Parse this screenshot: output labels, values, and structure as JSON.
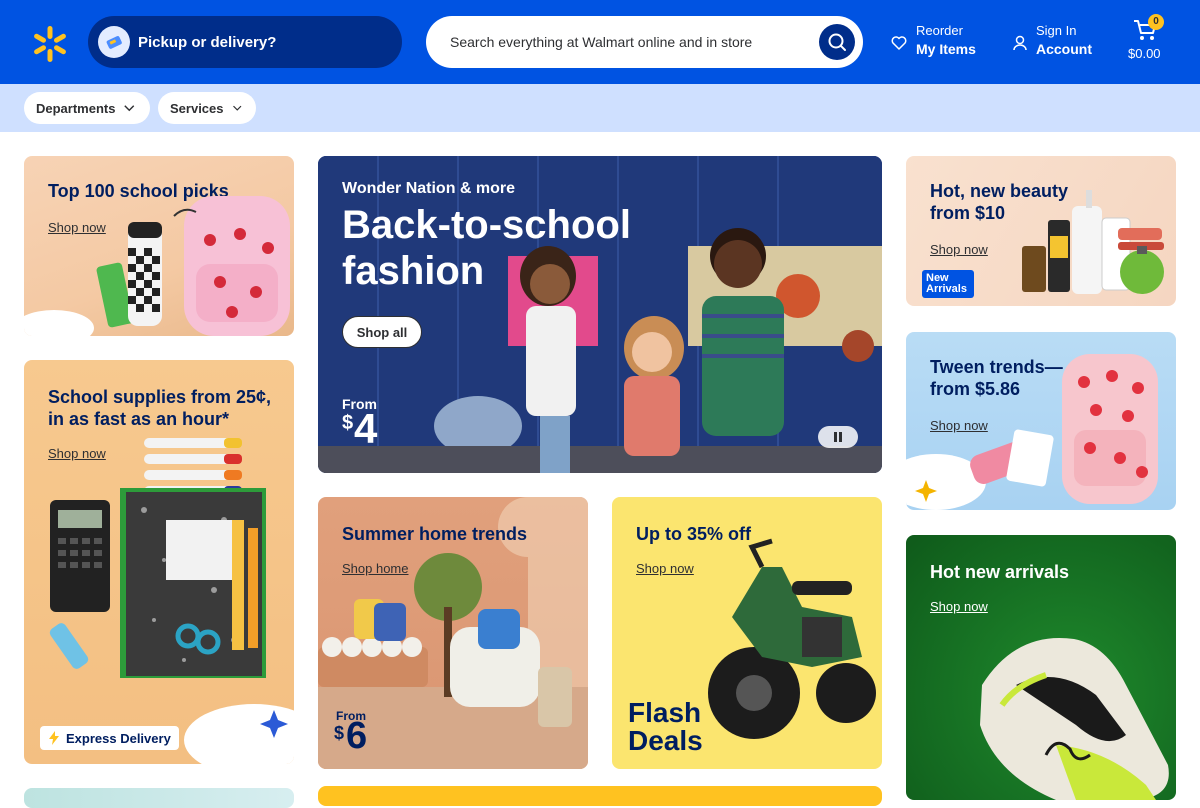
{
  "header": {
    "pickup_label": "Pickup or delivery?",
    "search_placeholder": "Search everything at Walmart online and in store",
    "reorder_small": "Reorder",
    "reorder_big": "My Items",
    "signin_small": "Sign In",
    "signin_big": "Account",
    "cart_count": "0",
    "cart_total": "$0.00"
  },
  "subnav": {
    "departments": "Departments",
    "services": "Services"
  },
  "cards": {
    "school_picks": {
      "title": "Top 100 school picks",
      "link": "Shop now"
    },
    "supplies": {
      "title": "School supplies from 25¢, in as fast as an hour*",
      "link": "Shop now",
      "badge": "Express Delivery"
    },
    "hero": {
      "eyebrow": "Wonder Nation & more",
      "title_line1": "Back-to-school",
      "title_line2": "fashion",
      "button": "Shop all",
      "price_prefix": "From",
      "price_currency": "$",
      "price_value": "4"
    },
    "summer": {
      "title": "Summer home trends",
      "link": "Shop home",
      "price_prefix": "From",
      "price_currency": "$",
      "price_value": "6"
    },
    "flash": {
      "title": "Up to 35% off",
      "link": "Shop now",
      "logo_line1": "Flash",
      "logo_line2": "Deals"
    },
    "beauty": {
      "title": "Hot, new beauty from $10",
      "link": "Shop now",
      "badge_line1": "New",
      "badge_line2": "Arrivals"
    },
    "tween": {
      "title": "Tween trends—from $5.86",
      "link": "Shop now"
    },
    "arrivals": {
      "title": "Hot new arrivals",
      "link": "Shop now"
    }
  },
  "colors": {
    "brand_blue": "#0053e2",
    "dark_blue": "#002d8a",
    "spark_yellow": "#ffc220",
    "subnav_bg": "#cfe0ff"
  }
}
